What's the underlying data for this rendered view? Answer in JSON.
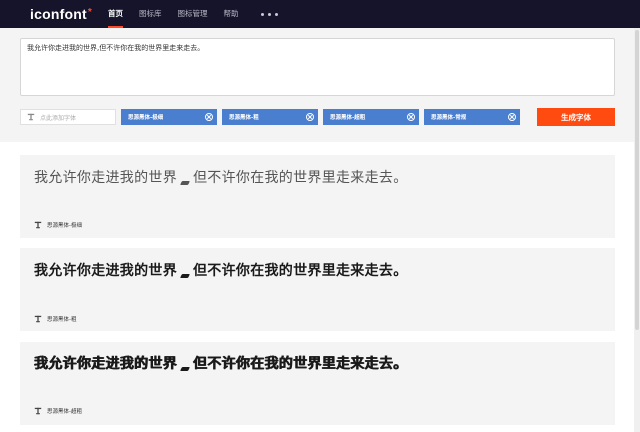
{
  "header": {
    "logo_text": "iconfont",
    "logo_mark": "*",
    "nav": [
      {
        "label": "首页",
        "active": true
      },
      {
        "label": "图标库",
        "active": false
      },
      {
        "label": "图标管理",
        "active": false
      },
      {
        "label": "帮助",
        "active": false
      }
    ],
    "more_icon": "ellipsis-icon"
  },
  "editor": {
    "text": "我允许你走进我的世界,但不许你在我的世界里走来走去。"
  },
  "font_picker": {
    "placeholder": "点此添加字体",
    "icon": "font-t-icon",
    "selected": [
      {
        "label": "思源黑体-极细"
      },
      {
        "label": "思源黑体-粗"
      },
      {
        "label": "思源黑体-超粗"
      },
      {
        "label": "思源黑体-常规"
      }
    ]
  },
  "generate_button": "生成字体",
  "previews": [
    {
      "part1": "我允许你走进我的世界",
      "part2": "但不许你在我的世界里走来走去。",
      "font_name": "思源黑体-极细"
    },
    {
      "part1": "我允许你走进我的世界",
      "part2": "但不许你在我的世界里走来走去。",
      "font_name": "思源黑体-粗"
    },
    {
      "part1": "我允许你走进我的世界",
      "part2": "但不许你在我的世界里走来走去。",
      "font_name": "思源黑体-超粗"
    }
  ],
  "colors": {
    "nav_bg": "#15142a",
    "accent": "#ff4a10",
    "chip": "#4a7fd0",
    "panel_bg": "#f4f4f4"
  }
}
